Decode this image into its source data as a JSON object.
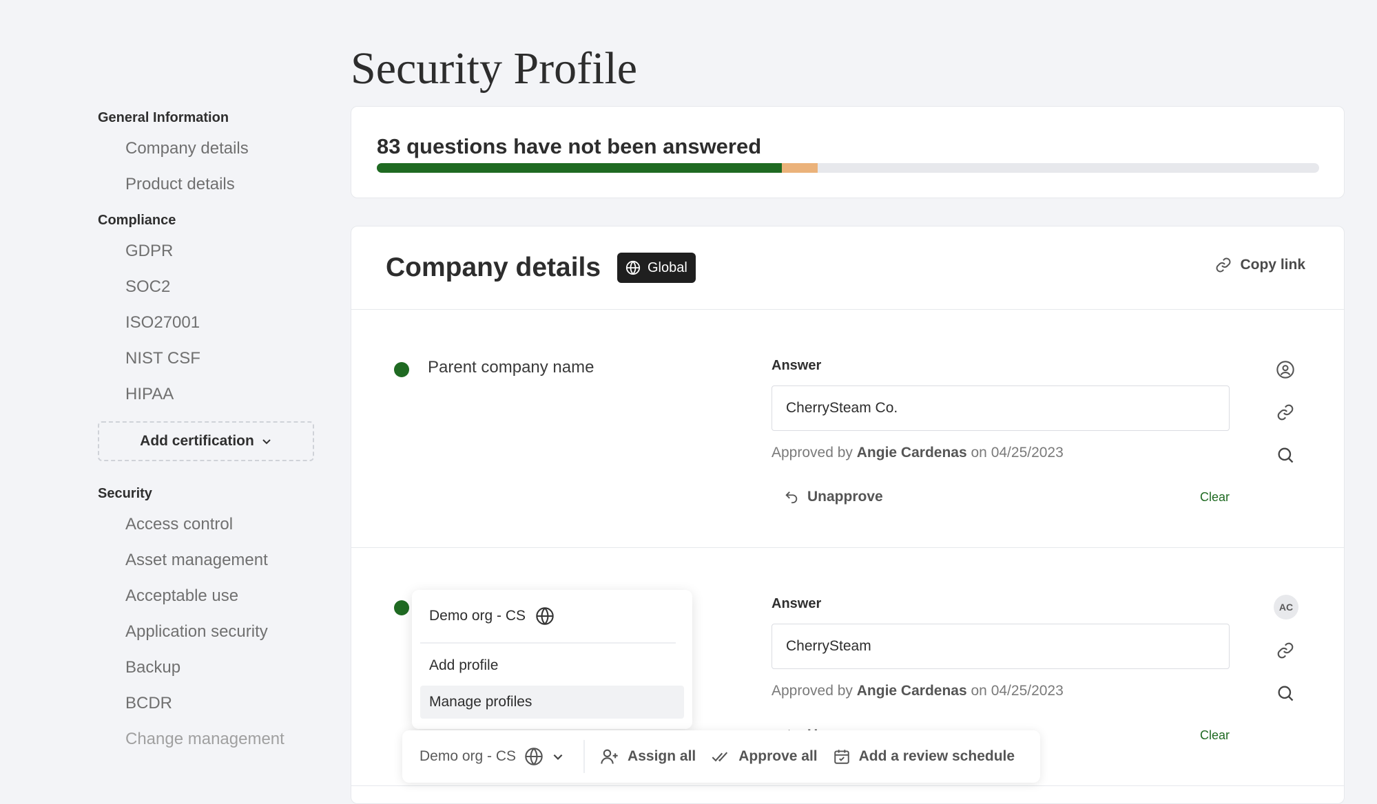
{
  "page_title": "Security Profile",
  "sidebar": {
    "sections": [
      {
        "title": "General Information",
        "items": [
          "Company details",
          "Product details"
        ]
      },
      {
        "title": "Compliance",
        "items": [
          "GDPR",
          "SOC2",
          "ISO27001",
          "NIST CSF",
          "HIPAA"
        ]
      },
      {
        "title": "Security",
        "items": [
          "Access control",
          "Asset management",
          "Acceptable use",
          "Application security",
          "Backup",
          "BCDR",
          "Change management"
        ]
      }
    ],
    "add_certification": "Add certification"
  },
  "progress": {
    "text": "83 questions have not been answered",
    "answered_fraction": 0.43,
    "pending_fraction": 0.038,
    "colors": {
      "answered": "#1f6a22",
      "pending": "#ebb27a",
      "track": "#e7e8ec"
    }
  },
  "details": {
    "title": "Company details",
    "badge": "Global",
    "copy_link": "Copy link"
  },
  "questions": [
    {
      "label": "Parent company name",
      "answer_label": "Answer",
      "answer_value": "CherrySteam Co.",
      "approved_prefix": "Approved by",
      "approver": "Angie Cardenas",
      "approved_on": "on 04/25/2023",
      "unapprove": "Unapprove",
      "clear": "Clear"
    },
    {
      "label": "",
      "answer_label": "Answer",
      "answer_value": "CherrySteam",
      "approved_prefix": "Approved by",
      "approver": "Angie Cardenas",
      "approved_on": "on 04/25/2023",
      "unapprove": "Unapprove",
      "clear": "Clear",
      "avatar": "AC"
    }
  ],
  "dropdown": {
    "current": "Demo org - CS",
    "items": [
      "Add profile",
      "Manage profiles"
    ]
  },
  "action_bar": {
    "profile": "Demo org - CS",
    "assign_all": "Assign all",
    "approve_all": "Approve all",
    "review_schedule": "Add a review schedule"
  },
  "icons": [
    "globe-icon",
    "link-icon",
    "user-circle-icon",
    "search-icon",
    "undo-icon",
    "chevron-down-icon",
    "user-plus-icon",
    "double-check-icon",
    "calendar-check-icon"
  ]
}
